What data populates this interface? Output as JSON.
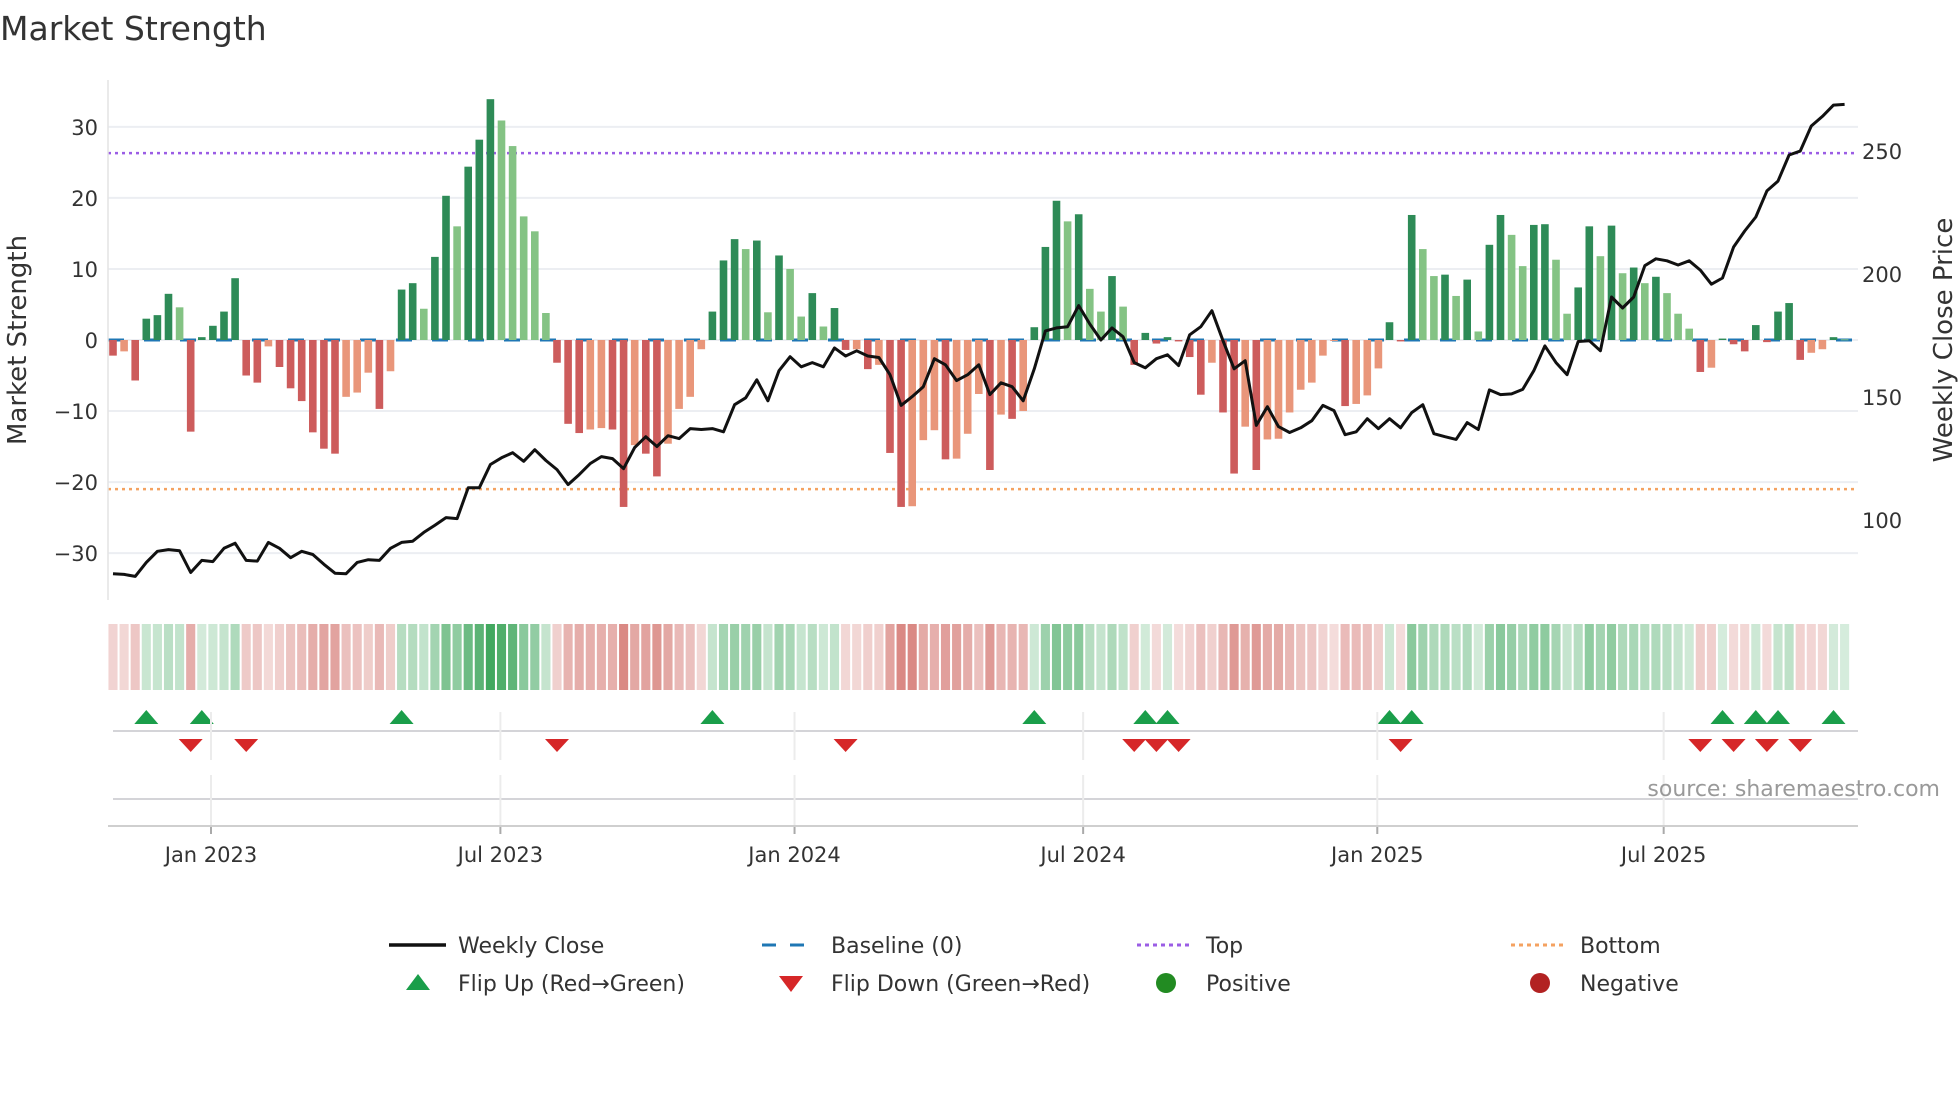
{
  "chart_data": {
    "type": "bar",
    "title": "Market Strength",
    "ylabel": "Market Strength",
    "y2label": "Weekly Close Price",
    "ylim": [
      -36.6,
      36.6
    ],
    "y2lim": [
      67.5,
      278.9
    ],
    "yticks": [
      -30,
      -20,
      -10,
      0,
      10,
      20,
      30
    ],
    "yticklabels": [
      "−30",
      "−20",
      "−10",
      "0",
      "10",
      "20",
      "30"
    ],
    "y2ticks": [
      100,
      150,
      200,
      250
    ],
    "y2ticklabels": [
      "100",
      "150",
      "200",
      "250"
    ],
    "xticks": [
      {
        "label": "Jan 2023",
        "week": 8.83
      },
      {
        "label": "Jul 2023",
        "week": 34.9
      },
      {
        "label": "Jan 2024",
        "week": 61.4
      },
      {
        "label": "Jul 2024",
        "week": 87.4
      },
      {
        "label": "Jan 2025",
        "week": 113.9
      },
      {
        "label": "Jul 2025",
        "week": 139.7
      }
    ],
    "top_level": 26.3,
    "bottom_level": -21,
    "baseline": 0,
    "strength": [
      -2.2,
      -1.6,
      -5.7,
      3,
      3.5,
      6.5,
      4.6,
      -12.9,
      0.4,
      2,
      4,
      8.7,
      -5,
      -6,
      -0.9,
      -3.8,
      -6.8,
      -8.6,
      -13,
      -15.3,
      -16,
      -8,
      -7.4,
      -4.6,
      -9.7,
      -4.4,
      7.1,
      8,
      4.4,
      11.7,
      20.3,
      16,
      24.4,
      28.2,
      33.9,
      30.9,
      27.3,
      17.4,
      15.3,
      3.8,
      -3.2,
      -11.8,
      -13.1,
      -12.6,
      -12.4,
      -12.6,
      -23.5,
      -14.8,
      -16,
      -19.2,
      -14.6,
      -9.7,
      -8,
      -1.3,
      4,
      11.2,
      14.2,
      12.8,
      14,
      3.9,
      11.9,
      10,
      3.3,
      6.6,
      1.9,
      4.5,
      -1.4,
      -1.3,
      -4.1,
      -3.5,
      -15.9,
      -23.5,
      -23.4,
      -14.1,
      -12.7,
      -16.8,
      -16.7,
      -13.2,
      -7.6,
      -18.3,
      -10.5,
      -11.1,
      -10,
      1.8,
      13.1,
      19.6,
      16.7,
      17.7,
      7.2,
      4,
      9,
      4.7,
      -3.5,
      1,
      -0.5,
      0.4,
      -0.2,
      -2.4,
      -7.7,
      -3.2,
      -10.2,
      -18.8,
      -12.2,
      -18.3,
      -14,
      -13.9,
      -10.2,
      -7,
      -6,
      -2.2,
      -0.1,
      -9.3,
      -9,
      -7.8,
      -4,
      2.5,
      -0.2,
      17.6,
      12.8,
      9,
      9.2,
      6.2,
      8.5,
      1.2,
      13.4,
      17.6,
      14.8,
      10.4,
      16.2,
      16.3,
      11.3,
      3.7,
      7.4,
      16,
      11.8,
      16.1,
      9.4,
      10.2,
      8,
      8.9,
      6.6,
      3.7,
      1.6,
      -4.5,
      -3.9,
      0.2,
      -0.6,
      -1.6,
      2.1,
      -0.3,
      4,
      5.2,
      -2.8,
      -1.8,
      -1.3,
      0.4,
      0.1
    ],
    "weekly_close": [
      78.2,
      77.9,
      77.1,
      82.8,
      87.3,
      88,
      87.5,
      78.7,
      83.6,
      83.1,
      88.5,
      90.6,
      83.6,
      83.3,
      90.9,
      88.5,
      84.7,
      87.3,
      86,
      82,
      78.4,
      78.2,
      82.8,
      83.9,
      83.6,
      88.5,
      90.9,
      91.4,
      95,
      97.9,
      101,
      100.6,
      113.1,
      113.1,
      122.6,
      125.3,
      127.4,
      123.9,
      128.6,
      124.2,
      120.5,
      114.4,
      118.5,
      123,
      125.8,
      125,
      120.9,
      129.5,
      133.9,
      129.9,
      134.3,
      133.1,
      137.2,
      136.8,
      137.2,
      135.9,
      146.9,
      149.7,
      157,
      148.5,
      160.7,
      166.4,
      162.3,
      164,
      162.3,
      170,
      166.7,
      168.8,
      166.7,
      166.1,
      159.1,
      146.6,
      150.2,
      154.2,
      165.6,
      163.1,
      156.7,
      159.1,
      163.1,
      151,
      155.8,
      154.2,
      148.5,
      161.5,
      176.9,
      178.1,
      178.6,
      187.2,
      179.7,
      173.2,
      178.1,
      174.5,
      164,
      161.9,
      165.6,
      167.2,
      162.8,
      175.3,
      178.6,
      185.1,
      172.9,
      161.5,
      164.8,
      138.5,
      146.1,
      138,
      135.6,
      137.5,
      140.4,
      146.6,
      144.5,
      134.7,
      135.9,
      141.2,
      137.2,
      141.2,
      137.5,
      143.7,
      146.9,
      135.1,
      133.9,
      132.8,
      139.6,
      136.8,
      152.9,
      151,
      151.3,
      153.1,
      160.7,
      170.8,
      164,
      159.1,
      172.6,
      172.9,
      168.8,
      190.7,
      186.2,
      190.7,
      203.4,
      206.2,
      205.4,
      203.7,
      205.4,
      201.6,
      195.9,
      198.4,
      211,
      217.5,
      223.2,
      233.8,
      237.8,
      248.4,
      250,
      260.2,
      264.1,
      268.7,
      269
    ],
    "flip_up_weeks": [
      3,
      8,
      26,
      54,
      83,
      93,
      95,
      115,
      117,
      145,
      148,
      150,
      155
    ],
    "flip_down_weeks": [
      7,
      12,
      40,
      66,
      92,
      94,
      96,
      116,
      143,
      146,
      149,
      152
    ],
    "legend": {
      "placement": "bottom",
      "items": [
        {
          "label": "Weekly Close",
          "key": "line"
        },
        {
          "label": "Baseline (0)",
          "key": "dash"
        },
        {
          "label": "Top",
          "key": "dot-top"
        },
        {
          "label": "Bottom",
          "key": "dot-bottom"
        },
        {
          "label": "Flip Up (Red→Green)",
          "key": "tri-up"
        },
        {
          "label": "Flip Down (Green→Red)",
          "key": "tri-down"
        },
        {
          "label": "Positive",
          "key": "circle-pos"
        },
        {
          "label": "Negative",
          "key": "circle-neg"
        }
      ]
    },
    "source": "source: sharemaestro.com",
    "grid": true
  },
  "colors": {
    "pos_strong": "#2e8b57",
    "pos_weak": "#84c384",
    "neg_strong": "#cd5c5c",
    "neg_weak": "#e9967a",
    "price": "#111111",
    "baseline": "#1f77b4",
    "top": "#9b5de5",
    "bottom": "#f4a261",
    "flip_up": "#1a9e4a",
    "flip_down": "#d62728",
    "positive": "#228b22",
    "negative": "#b22222",
    "strip_pos": "#2e9e4e",
    "strip_neg": "#c8514a"
  }
}
